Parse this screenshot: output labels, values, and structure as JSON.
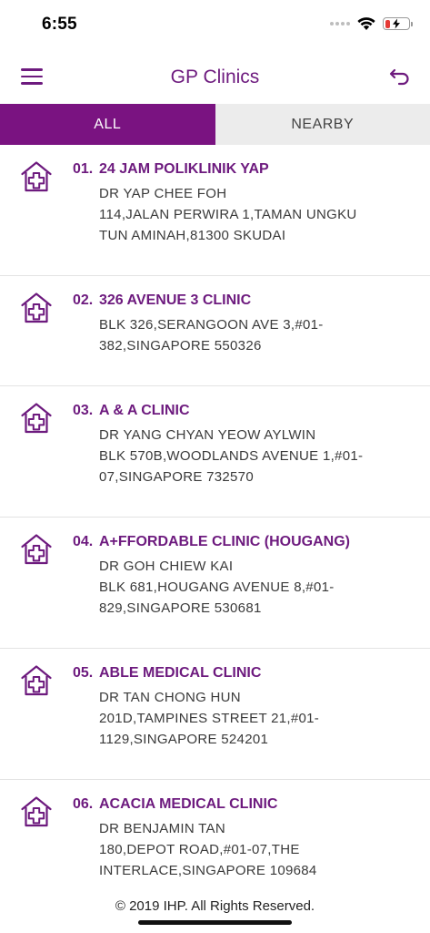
{
  "status": {
    "time": "6:55"
  },
  "header": {
    "title": "GP Clinics"
  },
  "tabs": [
    {
      "label": "ALL",
      "active": true
    },
    {
      "label": "NEARBY",
      "active": false
    }
  ],
  "clinics": [
    {
      "index": "01.",
      "name": "24 JAM POLIKLINIK YAP",
      "lines": [
        "DR YAP CHEE FOH",
        "114,JALAN PERWIRA 1,TAMAN UNGKU",
        "TUN AMINAH,81300 SKUDAI"
      ]
    },
    {
      "index": "02.",
      "name": "326 AVENUE 3 CLINIC",
      "lines": [
        "BLK 326,SERANGOON AVE 3,#01-",
        "382,SINGAPORE 550326"
      ]
    },
    {
      "index": "03.",
      "name": "A & A CLINIC",
      "lines": [
        "DR YANG CHYAN YEOW AYLWIN",
        "BLK 570B,WOODLANDS AVENUE 1,#01-",
        "07,SINGAPORE 732570"
      ]
    },
    {
      "index": "04.",
      "name": "A+FFORDABLE CLINIC (HOUGANG)",
      "lines": [
        "DR GOH CHIEW KAI",
        "BLK 681,HOUGANG AVENUE 8,#01-",
        "829,SINGAPORE 530681"
      ]
    },
    {
      "index": "05.",
      "name": "ABLE MEDICAL CLINIC",
      "lines": [
        "DR TAN CHONG HUN",
        "201D,TAMPINES STREET 21,#01-",
        "1129,SINGAPORE 524201"
      ]
    },
    {
      "index": "06.",
      "name": "ACACIA MEDICAL CLINIC",
      "lines": [
        "DR BENJAMIN TAN",
        "180,DEPOT ROAD,#01-07,THE",
        "INTERLACE,SINGAPORE 109684"
      ]
    }
  ],
  "footer": {
    "text": "© 2019 IHP. All Rights Reserved."
  },
  "icons": {
    "menu": "hamburger-menu-icon",
    "back": "return-arrow-icon",
    "clinic": "clinic-house-cross-icon",
    "wifi": "wifi-icon",
    "battery": "battery-charging-icon"
  },
  "colors": {
    "brand": "#6d1a7e",
    "tab_active_bg": "#7a1381",
    "tab_inactive_bg": "#ececec",
    "battery_low": "#e53935"
  },
  "battery_level": 0.2
}
